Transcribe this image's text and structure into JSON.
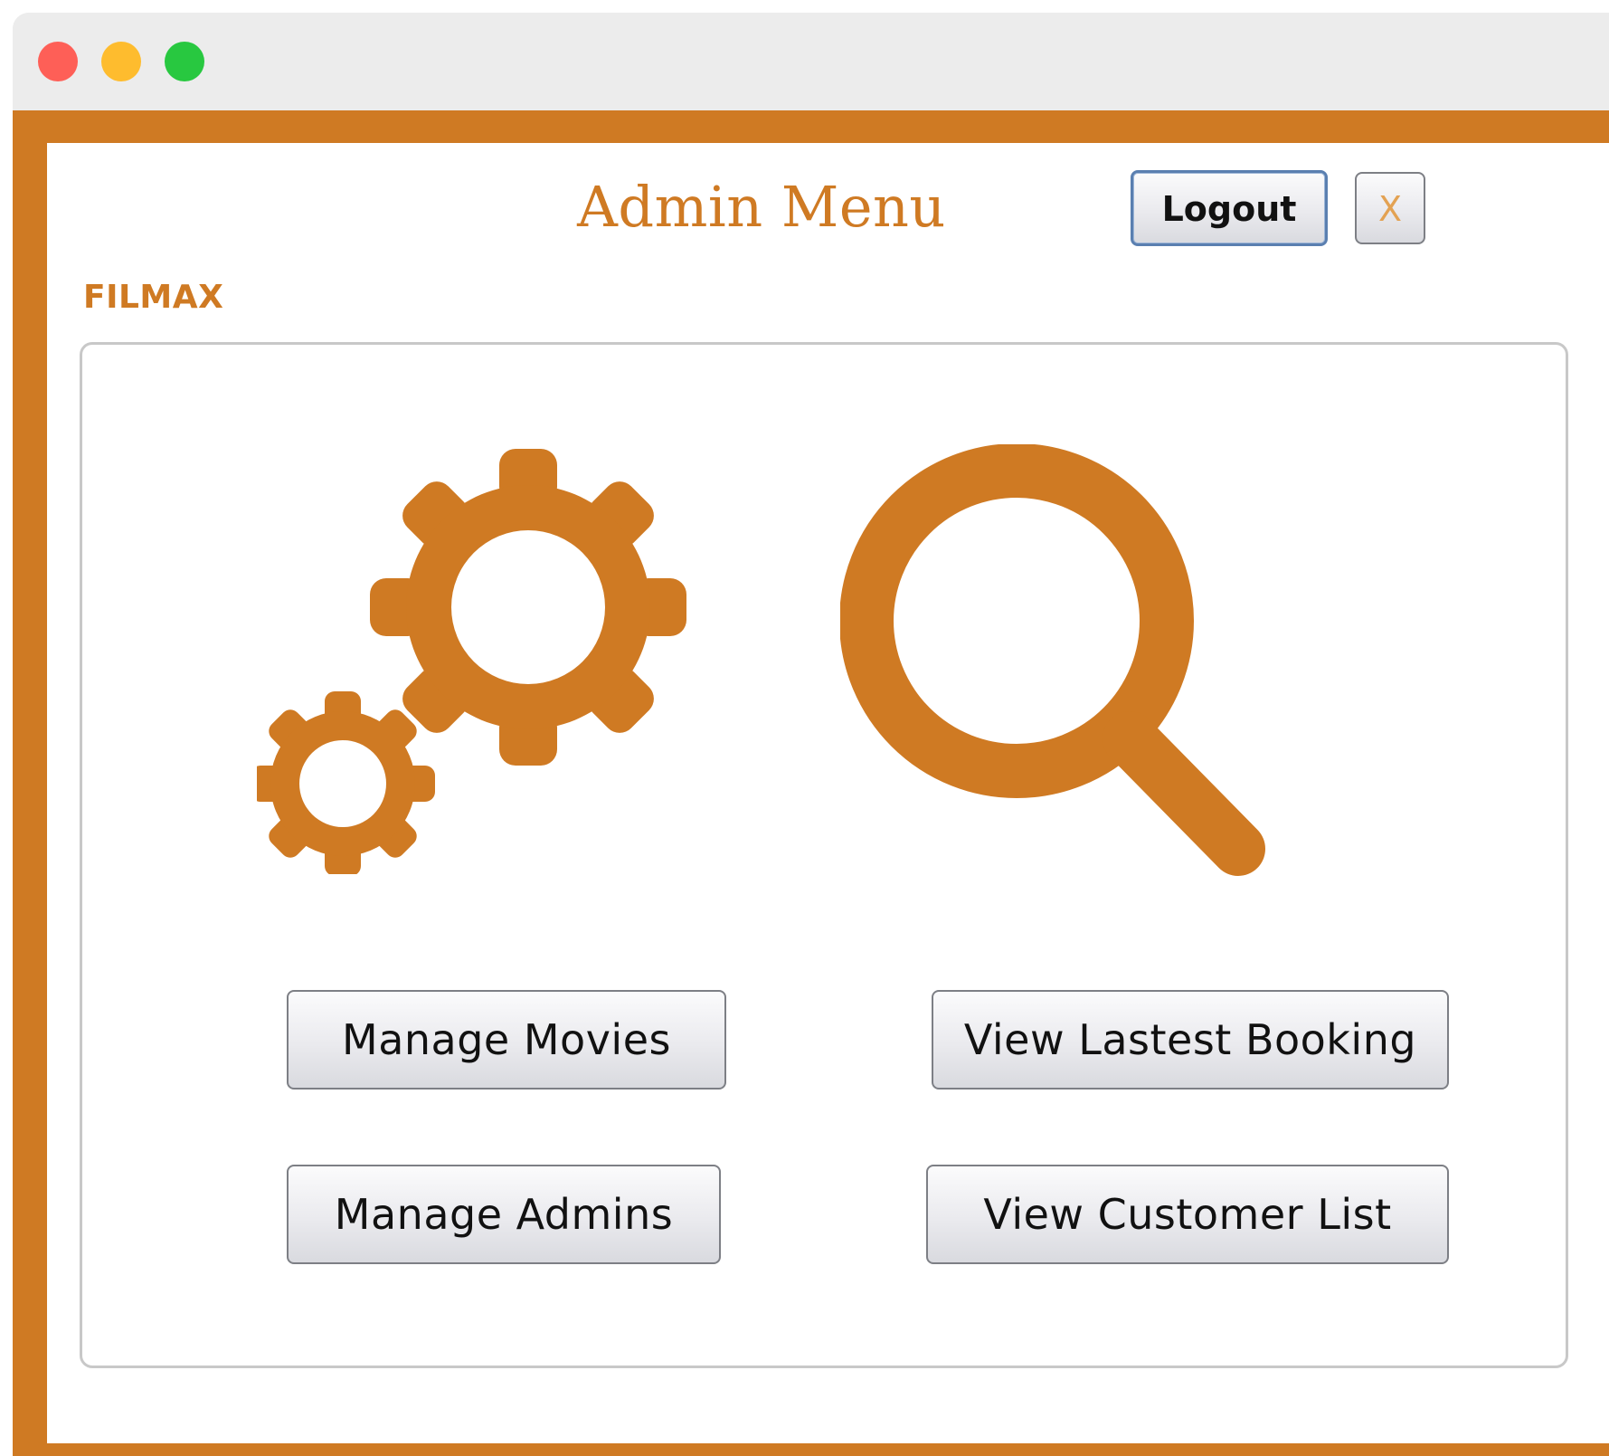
{
  "window": {
    "controls": [
      "close",
      "minimize",
      "zoom"
    ]
  },
  "header": {
    "title": "Admin Menu",
    "logout_label": "Logout",
    "close_label": "X"
  },
  "brand": {
    "name": "FILMAX"
  },
  "icons": {
    "left": "gears-icon",
    "right": "magnifier-icon"
  },
  "actions": {
    "manage_movies": "Manage Movies",
    "view_latest_booking": "View Lastest Booking",
    "manage_admins": "Manage Admins",
    "view_customer_list": "View Customer List"
  },
  "colors": {
    "accent": "#cf7a23",
    "background": "#ffffff",
    "button_border": "#7d7f85",
    "focus_border": "#5a7fb0"
  }
}
